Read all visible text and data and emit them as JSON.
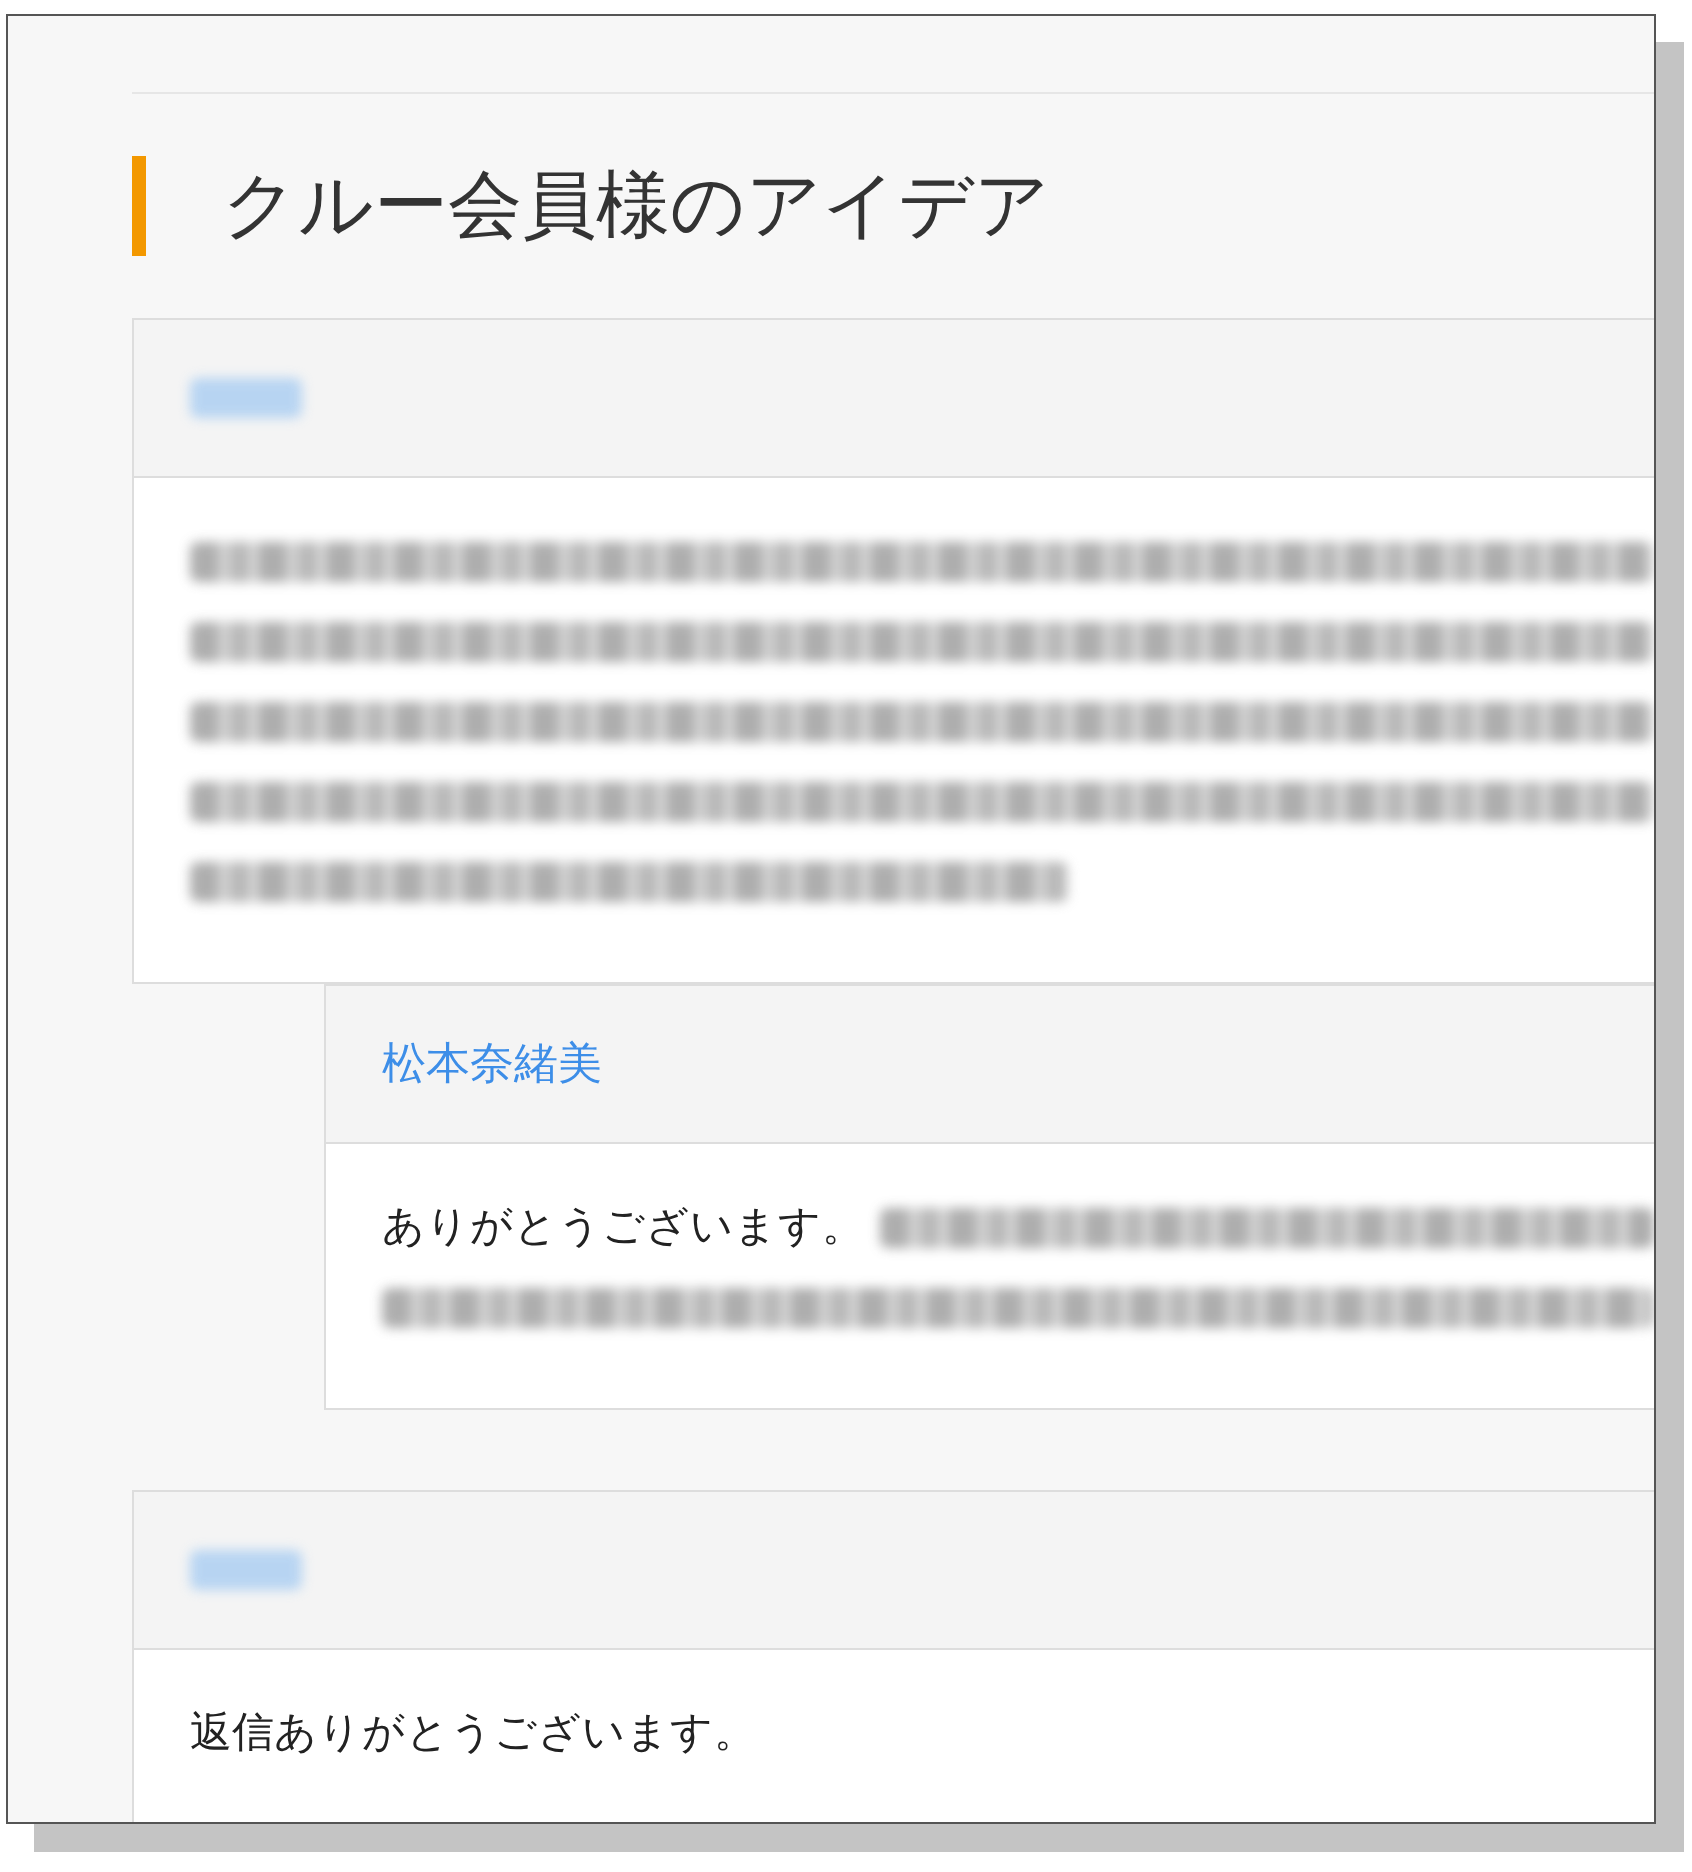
{
  "heading": "クルー会員様のアイデア",
  "comments": [
    {
      "reply": false,
      "author": {
        "kind": "blurred"
      },
      "lines": [
        [
          {
            "kind": "blurred"
          }
        ],
        [
          {
            "kind": "blurred"
          }
        ],
        [
          {
            "kind": "blurred"
          }
        ],
        [
          {
            "kind": "blurred"
          }
        ],
        [
          {
            "kind": "blurred",
            "short": true
          }
        ]
      ]
    },
    {
      "reply": true,
      "author": {
        "kind": "text",
        "text": "松本奈緒美"
      },
      "lines": [
        [
          {
            "kind": "text",
            "text": "ありがとうございます。"
          },
          {
            "kind": "blurred"
          }
        ],
        [
          {
            "kind": "blurred"
          }
        ]
      ]
    },
    {
      "reply": false,
      "author": {
        "kind": "blurred"
      },
      "lines": [
        [
          {
            "kind": "text",
            "text": "返信ありがとうございます。"
          }
        ]
      ]
    }
  ]
}
